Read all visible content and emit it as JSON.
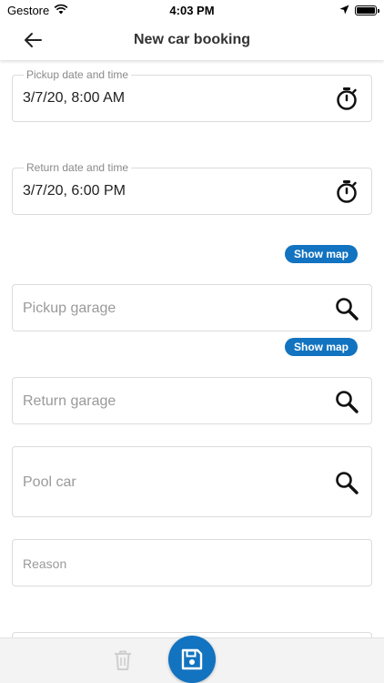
{
  "status_bar": {
    "carrier": "Gestore",
    "time": "4:03 PM"
  },
  "header": {
    "title": "New car booking"
  },
  "form": {
    "pickup_datetime": {
      "legend": "Pickup date and time",
      "value": "3/7/20, 8:00 AM"
    },
    "return_datetime": {
      "legend": "Return date and time",
      "value": "3/7/20, 6:00 PM"
    },
    "show_map_label": "Show map",
    "pickup_garage": {
      "placeholder": "Pickup garage"
    },
    "return_garage": {
      "placeholder": "Return garage"
    },
    "pool_car": {
      "placeholder": "Pool car"
    },
    "reason": {
      "placeholder": "Reason"
    }
  },
  "colors": {
    "accent": "#1273c0",
    "border": "#dcdcdc",
    "placeholder": "#9a9a9a"
  },
  "icons": {
    "back": "arrow-left-icon",
    "timer": "stopwatch-icon",
    "search": "magnifier-icon",
    "delete": "trash-icon",
    "save": "floppy-disk-icon"
  }
}
